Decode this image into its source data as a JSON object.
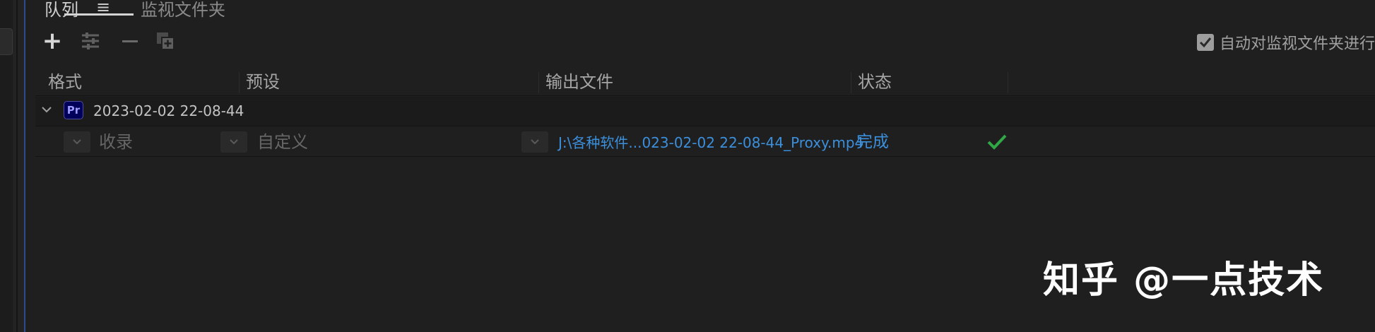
{
  "tabs": {
    "queue_label": "队列",
    "watch_folders_label": "监视文件夹"
  },
  "toolbar": {
    "auto_encode_label": "自动对监视文件夹进行",
    "auto_encode_checked": true
  },
  "columns": {
    "format": "格式",
    "preset": "预设",
    "output_file": "输出文件",
    "status": "状态"
  },
  "queue_group": {
    "app_badge": "Pr",
    "name": "2023-02-02 22-08-44"
  },
  "queue_item": {
    "format": "收录",
    "preset": "自定义",
    "output_file": "J:\\各种软件...023-02-02  22-08-44_Proxy.mp4",
    "status": "完成"
  },
  "watermark": "知乎 @一点技术",
  "colors": {
    "accent_link": "#3b8fdb",
    "success": "#2fa845",
    "premiere_badge_bg": "#00005b",
    "focus_border": "#2d4b8e"
  },
  "icons": [
    "add-icon",
    "settings-sliders-icon",
    "remove-icon",
    "duplicate-icon",
    "menu-icon",
    "chevron-down-icon",
    "checkmark-icon"
  ]
}
